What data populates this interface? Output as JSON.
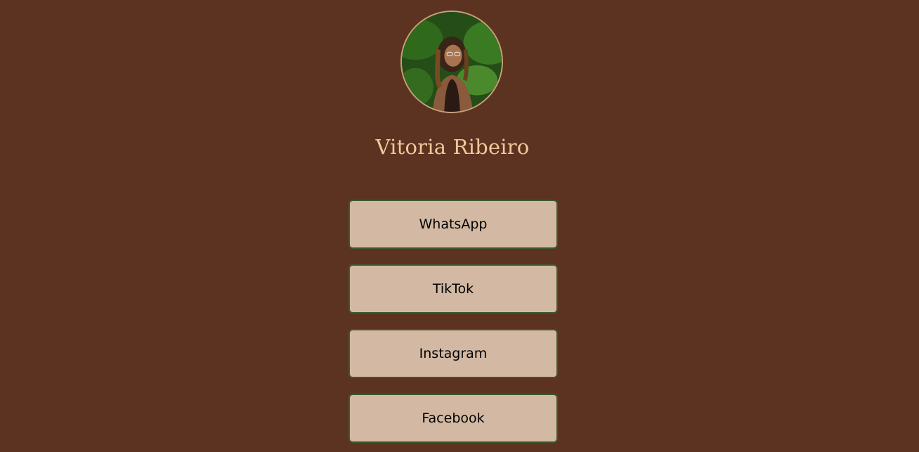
{
  "profile": {
    "name": "Vitoria Ribeiro"
  },
  "links": [
    {
      "label": "WhatsApp"
    },
    {
      "label": "TikTok"
    },
    {
      "label": "Instagram"
    },
    {
      "label": "Facebook"
    }
  ],
  "colors": {
    "background": "#5c3320",
    "name_text": "#f1c79b",
    "button_fill": "#d3b9a3",
    "button_border": "#3e5a2a",
    "avatar_border": "#c8a07a"
  }
}
